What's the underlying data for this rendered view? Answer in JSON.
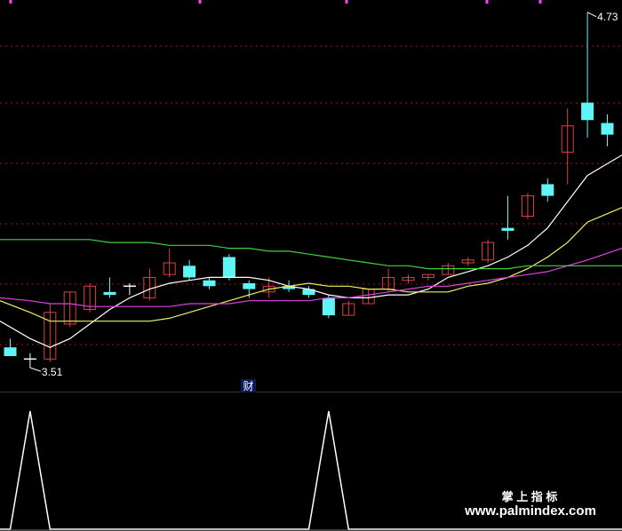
{
  "colors": {
    "background": "#000000",
    "up": "#e04040",
    "down": "#5ff5f5",
    "ma5": "#ffffff",
    "ma10": "#f0f060",
    "ma20": "#e040e0",
    "ma60": "#40d040",
    "grid": "#9a1f1f",
    "marker": "#ff40ff",
    "watermark": "#ffffff"
  },
  "labels": {
    "low": "3.51",
    "high": "4.73",
    "cai_badge": "财",
    "watermark_cn": "掌 上 指 标",
    "watermark_url": "www.palmindex.com"
  },
  "chart_data": [
    {
      "type": "candlestick",
      "title": "",
      "xlabel": "",
      "ylabel": "",
      "ylim": [
        3.48,
        4.76
      ],
      "grid": true,
      "categories": [
        1,
        2,
        3,
        4,
        5,
        6,
        7,
        8,
        9,
        10,
        11,
        12,
        13,
        14,
        15,
        16,
        17,
        18,
        19,
        20,
        21,
        22,
        23,
        24,
        25,
        26,
        27,
        28,
        29,
        30,
        31
      ],
      "ohlc": [
        {
          "o": 3.58,
          "h": 3.61,
          "l": 3.56,
          "c": 3.55
        },
        {
          "o": 3.54,
          "h": 3.56,
          "l": 3.51,
          "c": 3.54
        },
        {
          "o": 3.54,
          "h": 3.73,
          "l": 3.53,
          "c": 3.7
        },
        {
          "o": 3.66,
          "h": 3.77,
          "l": 3.65,
          "c": 3.77
        },
        {
          "o": 3.71,
          "h": 3.8,
          "l": 3.7,
          "c": 3.79
        },
        {
          "o": 3.77,
          "h": 3.82,
          "l": 3.75,
          "c": 3.76
        },
        {
          "o": 3.79,
          "h": 3.8,
          "l": 3.76,
          "c": 3.79
        },
        {
          "o": 3.75,
          "h": 3.85,
          "l": 3.74,
          "c": 3.82
        },
        {
          "o": 3.83,
          "h": 3.92,
          "l": 3.82,
          "c": 3.87
        },
        {
          "o": 3.86,
          "h": 3.88,
          "l": 3.81,
          "c": 3.82
        },
        {
          "o": 3.81,
          "h": 3.82,
          "l": 3.78,
          "c": 3.79
        },
        {
          "o": 3.89,
          "h": 3.9,
          "l": 3.81,
          "c": 3.82
        },
        {
          "o": 3.8,
          "h": 3.81,
          "l": 3.75,
          "c": 3.78
        },
        {
          "o": 3.77,
          "h": 3.82,
          "l": 3.75,
          "c": 3.79
        },
        {
          "o": 3.79,
          "h": 3.81,
          "l": 3.77,
          "c": 3.78
        },
        {
          "o": 3.78,
          "h": 3.79,
          "l": 3.75,
          "c": 3.76
        },
        {
          "o": 3.75,
          "h": 3.76,
          "l": 3.68,
          "c": 3.69
        },
        {
          "o": 3.69,
          "h": 3.74,
          "l": 3.69,
          "c": 3.73
        },
        {
          "o": 3.73,
          "h": 3.78,
          "l": 3.73,
          "c": 3.78
        },
        {
          "o": 3.78,
          "h": 3.85,
          "l": 3.77,
          "c": 3.82
        },
        {
          "o": 3.81,
          "h": 3.83,
          "l": 3.8,
          "c": 3.82
        },
        {
          "o": 3.82,
          "h": 3.83,
          "l": 3.81,
          "c": 3.83
        },
        {
          "o": 3.83,
          "h": 3.87,
          "l": 3.83,
          "c": 3.86
        },
        {
          "o": 3.87,
          "h": 3.89,
          "l": 3.86,
          "c": 3.88
        },
        {
          "o": 3.88,
          "h": 3.95,
          "l": 3.87,
          "c": 3.94
        },
        {
          "o": 3.99,
          "h": 4.1,
          "l": 3.95,
          "c": 3.98
        },
        {
          "o": 4.03,
          "h": 4.11,
          "l": 4.02,
          "c": 4.1
        },
        {
          "o": 4.14,
          "h": 4.16,
          "l": 4.08,
          "c": 4.1
        },
        {
          "o": 4.25,
          "h": 4.4,
          "l": 4.14,
          "c": 4.34
        },
        {
          "o": 4.42,
          "h": 4.73,
          "l": 4.3,
          "c": 4.36
        },
        {
          "o": 4.35,
          "h": 4.38,
          "l": 4.27,
          "c": 4.31
        }
      ],
      "moving_averages": [
        {
          "key": "ma5",
          "values": [
            3.67,
            3.61,
            3.58,
            3.61,
            3.66,
            3.71,
            3.75,
            3.78,
            3.8,
            3.81,
            3.82,
            3.82,
            3.82,
            3.81,
            3.79,
            3.78,
            3.76,
            3.75,
            3.75,
            3.76,
            3.76,
            3.78,
            3.82,
            3.84,
            3.86,
            3.89,
            3.93,
            3.99,
            4.08,
            4.17,
            4.24
          ]
        },
        {
          "key": "ma10",
          "values": [
            3.74,
            3.7,
            3.67,
            3.67,
            3.67,
            3.67,
            3.67,
            3.67,
            3.68,
            3.7,
            3.72,
            3.74,
            3.76,
            3.78,
            3.79,
            3.8,
            3.79,
            3.79,
            3.78,
            3.78,
            3.77,
            3.77,
            3.77,
            3.79,
            3.8,
            3.82,
            3.85,
            3.89,
            3.94,
            4.01,
            4.06
          ]
        },
        {
          "key": "ma20",
          "values": [
            3.75,
            3.74,
            3.73,
            3.73,
            3.72,
            3.72,
            3.72,
            3.72,
            3.72,
            3.73,
            3.73,
            3.73,
            3.74,
            3.74,
            3.74,
            3.74,
            3.75,
            3.75,
            3.76,
            3.77,
            3.78,
            3.79,
            3.79,
            3.8,
            3.81,
            3.82,
            3.83,
            3.84,
            3.86,
            3.88,
            3.92
          ]
        },
        {
          "key": "ma60",
          "values": [
            3.95,
            3.95,
            3.95,
            3.95,
            3.95,
            3.94,
            3.94,
            3.94,
            3.93,
            3.93,
            3.93,
            3.92,
            3.92,
            3.91,
            3.91,
            3.9,
            3.89,
            3.88,
            3.87,
            3.86,
            3.86,
            3.85,
            3.85,
            3.85,
            3.85,
            3.85,
            3.86,
            3.86,
            3.86,
            3.86,
            3.86
          ]
        }
      ]
    },
    {
      "type": "line",
      "title": "",
      "xlabel": "",
      "ylabel": "",
      "ylim": [
        0,
        1
      ],
      "x": [
        0,
        1,
        2,
        3,
        4,
        5,
        6,
        7,
        8,
        9,
        10,
        11,
        12,
        13,
        14,
        15,
        16,
        17,
        18,
        19,
        20,
        21,
        22,
        23,
        24,
        25,
        26,
        27,
        28,
        29,
        30,
        31
      ],
      "series": [
        {
          "values": [
            0,
            0,
            1,
            0,
            0,
            0,
            0,
            0,
            0,
            0,
            0,
            0,
            0,
            0,
            0,
            0,
            0,
            1,
            0,
            0,
            0,
            0,
            0,
            0,
            0,
            0,
            0,
            0,
            0,
            0,
            0,
            0
          ]
        }
      ]
    }
  ]
}
